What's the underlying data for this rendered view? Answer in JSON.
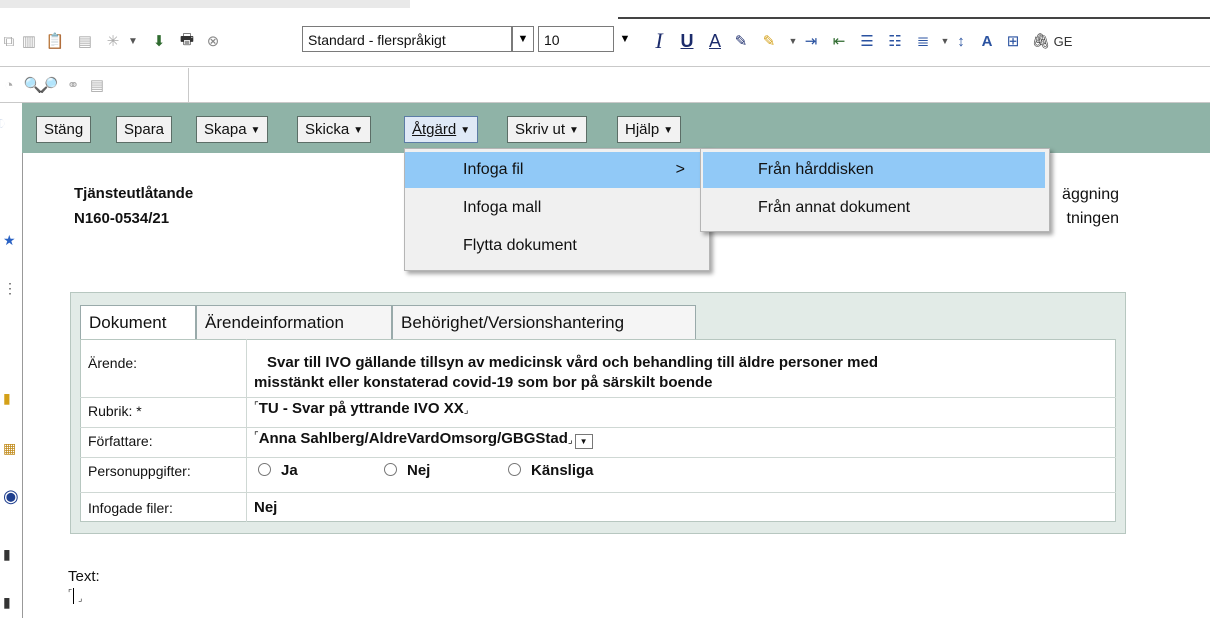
{
  "toolbar": {
    "style_select": "Standard - flerspråkigt",
    "size_select": "10",
    "icons": [
      "copy-icon",
      "paste-icon",
      "paste-special-icon",
      "insert-icon",
      "download-icon",
      "print-icon",
      "delete-icon",
      "italic-icon",
      "underline-icon",
      "font-color-icon",
      "pen-icon",
      "highlight-icon",
      "indent-icon",
      "outdent-icon",
      "bullets-icon",
      "numbering-icon",
      "align-icon",
      "line-spacing-icon",
      "spellcheck-icon",
      "table-icon",
      "attach-icon"
    ],
    "bold_glyph": "I",
    "underline_glyph": "U",
    "fontcolor_glyph": "A",
    "trailing_text": "GE"
  },
  "actionbar": {
    "buttons": [
      {
        "label": "Stäng",
        "arrow": false
      },
      {
        "label": "Spara",
        "arrow": false
      },
      {
        "label": "Skapa",
        "arrow": true
      },
      {
        "label": "Skicka",
        "arrow": true
      },
      {
        "label": "Åtgärd",
        "arrow": true
      },
      {
        "label": "Skriv ut",
        "arrow": true
      },
      {
        "label": "Hjälp",
        "arrow": true
      }
    ]
  },
  "header": {
    "doc_type": "Tjänsteutlåtande",
    "doc_number": "N160-0534/21",
    "right_line1": "äggning",
    "right_line2": "tningen"
  },
  "tabs": [
    "Dokument",
    "Ärendeinformation",
    "Behörighet/Versionshantering"
  ],
  "form": {
    "arende_label": "Ärende:",
    "arende_value_1": "Svar till IVO gällande tillsyn av medicinsk vård och behandling till äldre personer med",
    "arende_value_2": "misstänkt eller konstaterad covid-19 som bor på särskilt boende",
    "rubrik_label": "Rubrik: *",
    "rubrik_value": "TU - Svar på yttrande IVO XX",
    "forfattare_label": "Författare:",
    "forfattare_value": "Anna Sahlberg/AldreVardOmsorg/GBGStad",
    "person_label": "Personuppgifter:",
    "person_options": [
      "Ja",
      "Nej",
      "Känsliga"
    ],
    "infogade_label": "Infogade filer:",
    "infogade_value": "Nej"
  },
  "body": {
    "text_label": "Text:"
  },
  "menu": {
    "items": [
      "Infoga fil",
      "Infoga mall",
      "Flytta dokument"
    ],
    "submenu_arrow": ">",
    "submenu": [
      "Från hårddisken",
      "Från annat dokument"
    ]
  }
}
